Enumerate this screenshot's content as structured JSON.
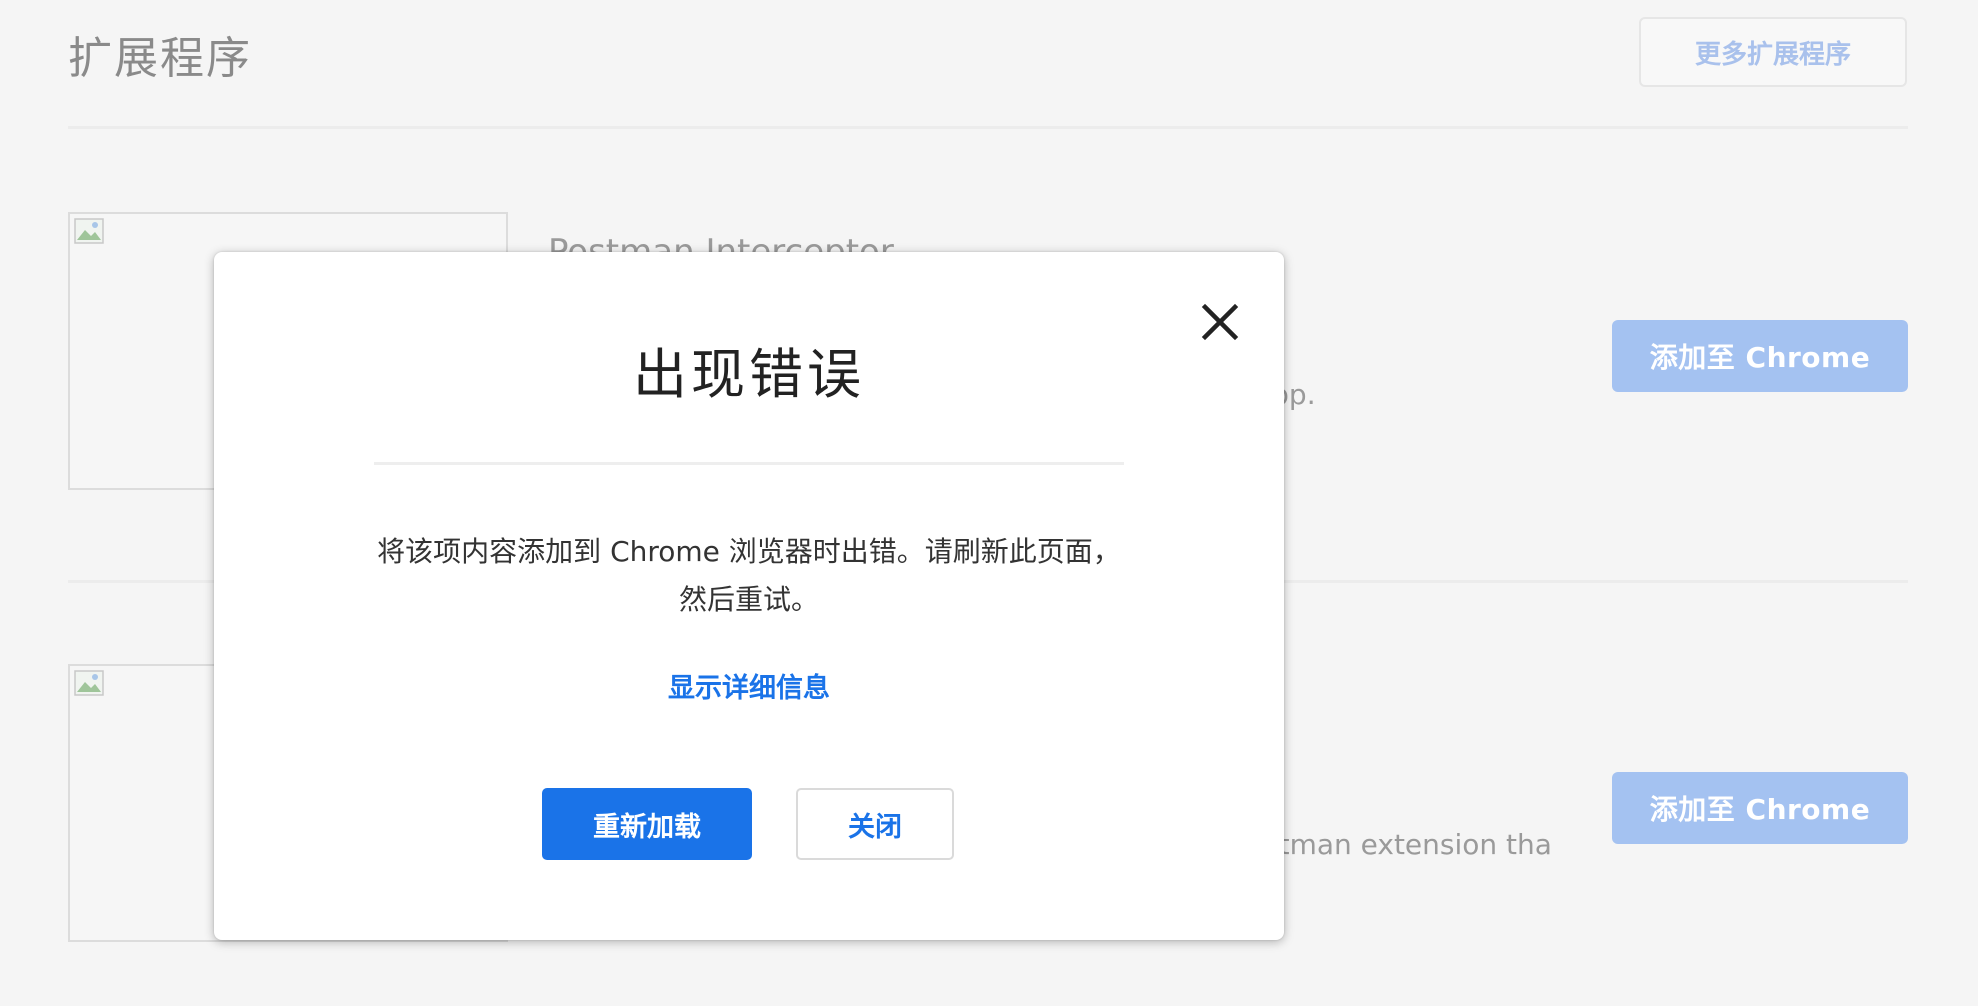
{
  "page": {
    "section_title": "扩展程序",
    "more_button": "更多扩展程序"
  },
  "extensions": [
    {
      "name": "Postman Interceptor",
      "desc_visible": "app.",
      "add_label": "添加至 Chrome"
    },
    {
      "desc_visible": "stman extension tha",
      "add_label": "添加至 Chrome"
    }
  ],
  "dialog": {
    "title": "出现错误",
    "message": "将该项内容添加到 Chrome 浏览器时出错。请刷新此页面，然后重试。",
    "details_link": "显示详细信息",
    "reload_button": "重新加载",
    "close_button": "关闭",
    "close_icon": "close-icon"
  },
  "colors": {
    "primary": "#1a73e8",
    "disabled_primary": "#a4c2f1",
    "background": "#f5f5f5"
  }
}
